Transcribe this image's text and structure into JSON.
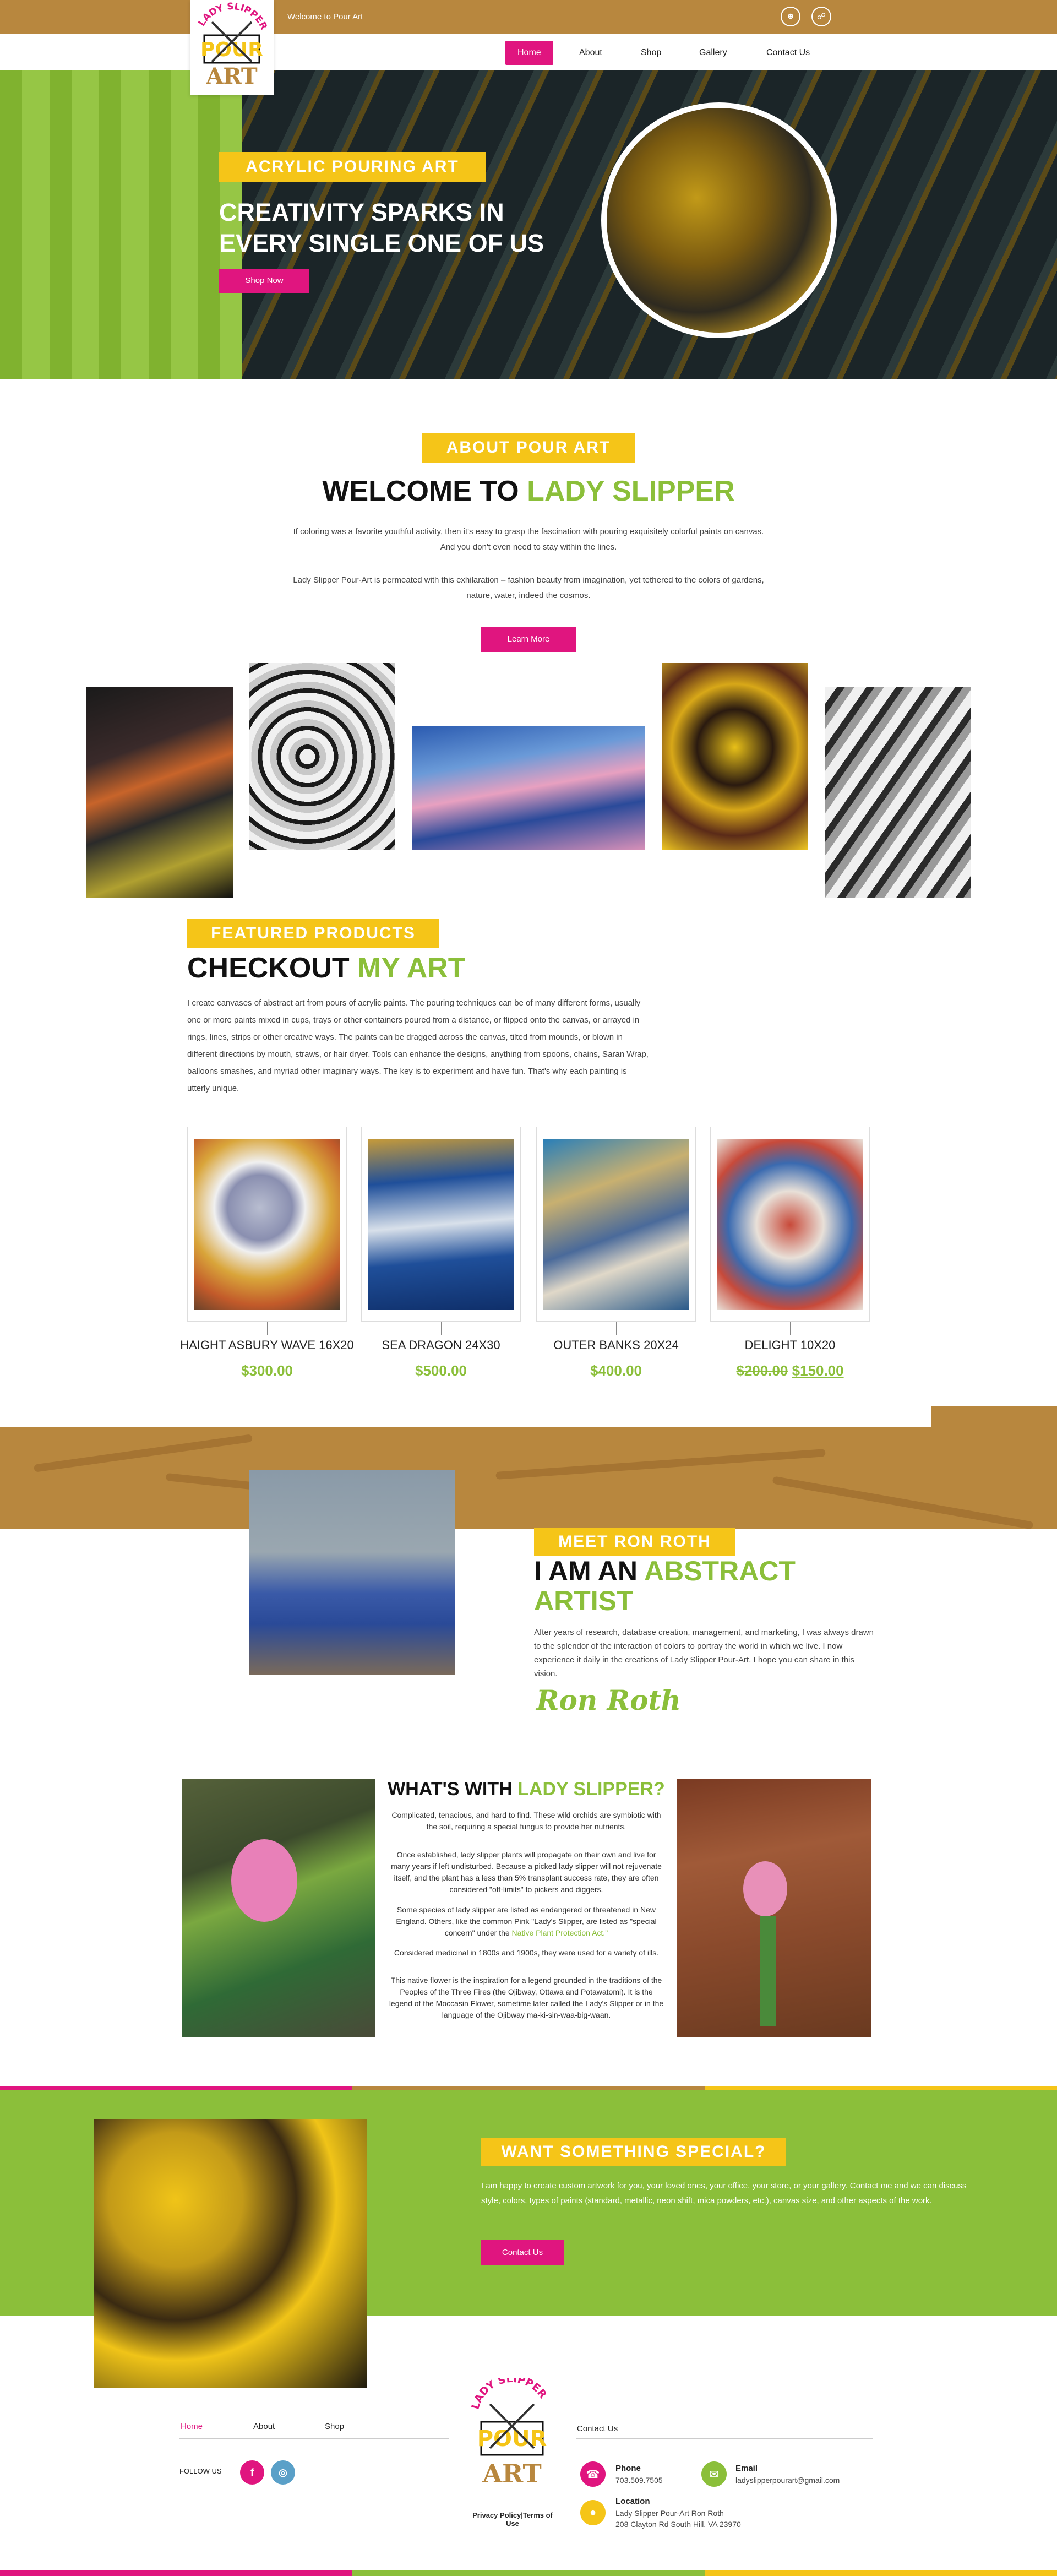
{
  "topbar": {
    "welcome": "Welcome to Pour Art",
    "icons": [
      "user-icon",
      "cart-icon"
    ]
  },
  "nav": {
    "items": [
      "Home",
      "About",
      "Shop",
      "Gallery",
      "Contact Us"
    ],
    "active": "Home"
  },
  "hero": {
    "tag": "ACRYLIC POURING ART",
    "title_line1": "CREATIVITY SPARKS IN",
    "title_line2": "EVERY SINGLE ONE OF US",
    "button": "Shop Now"
  },
  "about": {
    "tag": "ABOUT POUR ART",
    "title_black": "WELCOME TO ",
    "title_green": "LADY SLIPPER",
    "p1": "If coloring was a favorite youthful activity, then it's easy to grasp the fascination with pouring exquisitely colorful paints on canvas. And you don't even need to stay within the lines.",
    "p2": "Lady Slipper Pour-Art is permeated with this exhilaration – fashion beauty from imagination, yet tethered to the colors of gardens, nature, water, indeed the cosmos.",
    "button": "Learn More"
  },
  "featured": {
    "tag": "FEATURED PRODUCTS",
    "title_black": "CHECKOUT ",
    "title_green": "MY ART",
    "desc": "I create canvases of abstract art from pours of acrylic paints. The pouring techniques can be of many different forms, usually one or more paints mixed in cups, trays or other containers poured from a distance, or flipped onto the canvas, or arrayed in rings, lines, strips or other creative ways. The paints can be dragged across the canvas, tilted from mounds, or blown in different directions by mouth, straws, or hair dryer. Tools can enhance the designs, anything from spoons, chains, Saran Wrap, balloons smashes, and myriad other imaginary ways. The key is to experiment and have fun. That's why each painting is utterly unique.",
    "products": [
      {
        "name": "HAIGHT ASBURY WAVE 16X20",
        "price": "$300.00",
        "old_price": "",
        "colors": [
          "#d9a53a",
          "#8a8fb0",
          "#c25a2a"
        ]
      },
      {
        "name": "SEA DRAGON 24X30",
        "price": "$500.00",
        "old_price": "",
        "colors": [
          "#1f4f9a",
          "#d8e0ea",
          "#c59a3a"
        ]
      },
      {
        "name": "OUTER BANKS 20X24",
        "price": "$400.00",
        "old_price": "",
        "colors": [
          "#2a7fb8",
          "#c8b070",
          "#4a6a9a"
        ]
      },
      {
        "name": "DELIGHT 10X20",
        "price": "$150.00",
        "old_price": "$200.00",
        "colors": [
          "#c84a3a",
          "#3a6ab0",
          "#e8e0d8"
        ]
      }
    ]
  },
  "meet": {
    "tag": "MEET RON ROTH",
    "title_black": "I AM AN ",
    "title_green": "ABSTRACT ARTIST",
    "text": "After years of research, database creation, management, and marketing, I was always drawn to the splendor of the interaction of colors to portray the world in which we live. I now experience it daily in the creations of Lady Slipper Pour-Art. I hope you can share in this vision.",
    "signature": "Ron Roth"
  },
  "whats": {
    "title_black": "WHAT'S WITH ",
    "title_green": "LADY SLIPPER?",
    "p1": "Complicated, tenacious, and hard to find. These wild orchids are symbiotic with the soil, requiring a special fungus to provide her nutrients.",
    "p2": "Once established, lady slipper plants will propagate on their own and live for many years if left undisturbed. Because a picked lady slipper will not rejuvenate itself, and the plant has a less than 5% transplant success rate, they are often considered \"off-limits\" to pickers and diggers.",
    "p3_pre": "Some species of lady slipper are listed as endangered or threatened in New England. Others, like the common Pink \"Lady's Slipper, are listed as \"special concern\" under the ",
    "p3_link": "Native Plant Protection Act.\"",
    "p4": "Considered medicinal in 1800s and 1900s, they were used for a variety of ills.",
    "p5": "This native flower is the inspiration for a legend grounded in the traditions of the Peoples of the Three Fires (the Ojibway, Ottawa and Potawatomi). It is the legend of the Moccasin Flower, sometime later called the Lady's Slipper or in the language of the Ojibway ma-ki-sin-waa-big-waan."
  },
  "special": {
    "tag": "WANT SOMETHING SPECIAL?",
    "text": "I am happy to create custom artwork for you, your loved ones, your office, your store, or your gallery. Contact me and we can discuss style, colors, types of paints (standard, metallic, neon shift, mica powders, etc.), canvas size, and other aspects of the work.",
    "button": "Contact Us"
  },
  "footer": {
    "links": [
      "Home",
      "About",
      "Shop"
    ],
    "follow": "FOLLOW US",
    "social": [
      "f",
      "◎"
    ],
    "policy": "Privacy Policy|Terms of Use",
    "contact_title": "Contact Us",
    "phone_label": "Phone",
    "phone": "703.509.7505",
    "email_label": "Email",
    "email": "ladyslipperpourart@gmail.com",
    "location_label": "Location",
    "location_line1": "Lady Slipper Pour-Art Ron Roth",
    "location_line2": "208 Clayton Rd South Hill, VA 23970"
  },
  "logo": {
    "top_text": "LADY SLIPPER",
    "middle": "POUR",
    "bottom": "ART"
  },
  "colors": {
    "brown": "#b8873e",
    "pink": "#e0157f",
    "green": "#8bbf3a",
    "yellow": "#f5c518"
  }
}
